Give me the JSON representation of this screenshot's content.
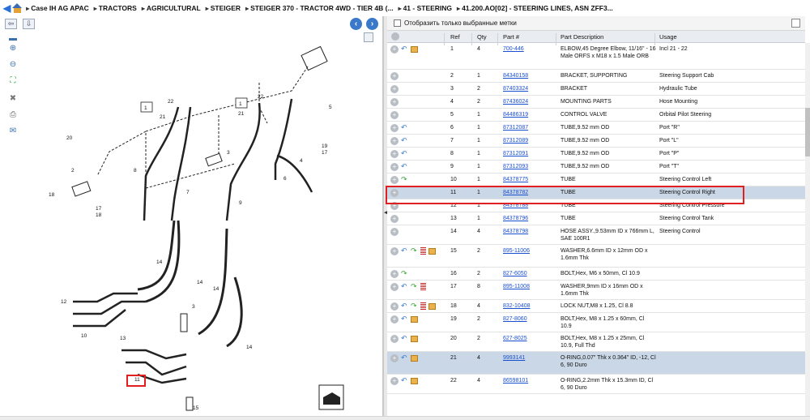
{
  "breadcrumb": {
    "items": [
      "Case IH AG APAC",
      "TRACTORS",
      "AGRICULTURAL",
      "STEIGER",
      "STEIGER 370 - TRACTOR 4WD - TIER 4B (...",
      "41 - STEERING",
      "41.200.AO[02] - STEERING LINES, ASN ZFF3..."
    ],
    "nav_icon": "back-arrow-icon",
    "home_icon": "home-icon"
  },
  "filter": {
    "label": "Отобразить только выбранные метки",
    "checked": false
  },
  "grid": {
    "columns": [
      "Ref",
      "Qty",
      "Part #",
      "Part Description",
      "Usage"
    ],
    "rows": [
      {
        "icons": [
          "undo",
          "box"
        ],
        "ref": "1",
        "qty": "4",
        "part": "700-446",
        "desc": "ELBOW,45 Degree Elbow, 11/16\" - 16 Male ORFS x M18 x 1.5 Male ORB",
        "usage": "Incl 21 - 22"
      },
      {
        "icons": [],
        "ref": "2",
        "qty": "1",
        "part": "84340158",
        "desc": "BRACKET, SUPPORTING",
        "usage": "Steering Support Cab"
      },
      {
        "icons": [],
        "ref": "3",
        "qty": "2",
        "part": "87403324",
        "desc": "BRACKET",
        "usage": "Hydraulic Tube"
      },
      {
        "icons": [],
        "ref": "4",
        "qty": "2",
        "part": "87436024",
        "desc": "MOUNTING PARTS",
        "usage": "Hose Mounting"
      },
      {
        "icons": [],
        "ref": "5",
        "qty": "1",
        "part": "84486319",
        "desc": "CONTROL VALVE",
        "usage": "Orbital Pilot Steering"
      },
      {
        "icons": [
          "undo"
        ],
        "ref": "6",
        "qty": "1",
        "part": "87312087",
        "desc": "TUBE,9.52 mm OD",
        "usage": "Port \"R\""
      },
      {
        "icons": [
          "undo"
        ],
        "ref": "7",
        "qty": "1",
        "part": "87312089",
        "desc": "TUBE,9.52 mm OD",
        "usage": "Port \"L\""
      },
      {
        "icons": [
          "undo"
        ],
        "ref": "8",
        "qty": "1",
        "part": "87312091",
        "desc": "TUBE,9.52 mm OD",
        "usage": "Port \"P\""
      },
      {
        "icons": [
          "undo"
        ],
        "ref": "9",
        "qty": "1",
        "part": "87312093",
        "desc": "TUBE,9.52 mm OD",
        "usage": "Port \"T\""
      },
      {
        "icons": [
          "redo"
        ],
        "ref": "10",
        "qty": "1",
        "part": "84378775",
        "desc": "TUBE",
        "usage": "Steering Control Left"
      },
      {
        "icons": [],
        "ref": "11",
        "qty": "1",
        "part": "84378782",
        "desc": "TUBE",
        "usage": "Steering Control Right",
        "selected": true
      },
      {
        "icons": [],
        "ref": "12",
        "qty": "1",
        "part": "84378788",
        "desc": "TUBE",
        "usage": "Steering Control Pressure"
      },
      {
        "icons": [],
        "ref": "13",
        "qty": "1",
        "part": "84378796",
        "desc": "TUBE",
        "usage": "Steering Control Tank"
      },
      {
        "icons": [],
        "ref": "14",
        "qty": "4",
        "part": "84378798",
        "desc": "HOSE ASSY.,9.53mm ID x 766mm L, SAE 100R1",
        "usage": "Steering Control"
      },
      {
        "icons": [
          "undo",
          "redo",
          "doc",
          "box"
        ],
        "ref": "15",
        "qty": "2",
        "part": "895-11006",
        "desc": "WASHER,6.6mm ID x 12mm OD x 1.6mm Thk",
        "usage": ""
      },
      {
        "icons": [
          "redo"
        ],
        "ref": "16",
        "qty": "2",
        "part": "827-6050",
        "desc": "BOLT,Hex, M6 x 50mm, Cl 10.9",
        "usage": ""
      },
      {
        "icons": [
          "undo",
          "redo",
          "doc"
        ],
        "ref": "17",
        "qty": "8",
        "part": "895-11008",
        "desc": "WASHER,9mm ID x 16mm OD x 1.6mm Thk",
        "usage": ""
      },
      {
        "icons": [
          "undo",
          "redo",
          "doc",
          "box"
        ],
        "ref": "18",
        "qty": "4",
        "part": "832-10408",
        "desc": "LOCK NUT,M8 x 1.25, Cl 8.8",
        "usage": ""
      },
      {
        "icons": [
          "undo",
          "box"
        ],
        "ref": "19",
        "qty": "2",
        "part": "827-8060",
        "desc": "BOLT,Hex, M8 x 1.25 x 60mm, Cl 10.9",
        "usage": ""
      },
      {
        "icons": [
          "undo",
          "box"
        ],
        "ref": "20",
        "qty": "2",
        "part": "627-8025",
        "desc": "BOLT,Hex, M8 x 1.25 x 25mm, Cl 10.9, Full Thd",
        "usage": ""
      },
      {
        "icons": [
          "undo",
          "box"
        ],
        "ref": "21",
        "qty": "4",
        "part": "9993141",
        "desc": "O-RING,0.07\" Thk x 0.364\" ID, -12, Cl 6, 90 Duro",
        "usage": "",
        "shaded": true
      },
      {
        "icons": [
          "undo",
          "box"
        ],
        "ref": "22",
        "qty": "4",
        "part": "86598101",
        "desc": "O-RING,2.2mm Thk x 15.3mm ID, Cl 6, 90 Duro",
        "usage": ""
      }
    ]
  },
  "diagram": {
    "callouts": [
      "1",
      "2",
      "3",
      "4",
      "5",
      "6",
      "7",
      "8",
      "9",
      "10",
      "11",
      "12",
      "13",
      "14",
      "15",
      "16",
      "17",
      "18",
      "19",
      "20",
      "21",
      "22"
    ]
  },
  "colors": {
    "link": "#1a4fcf",
    "selected_row": "#c9d7e6",
    "highlight": "#e02020",
    "header_bg": "#e9ecf0"
  }
}
